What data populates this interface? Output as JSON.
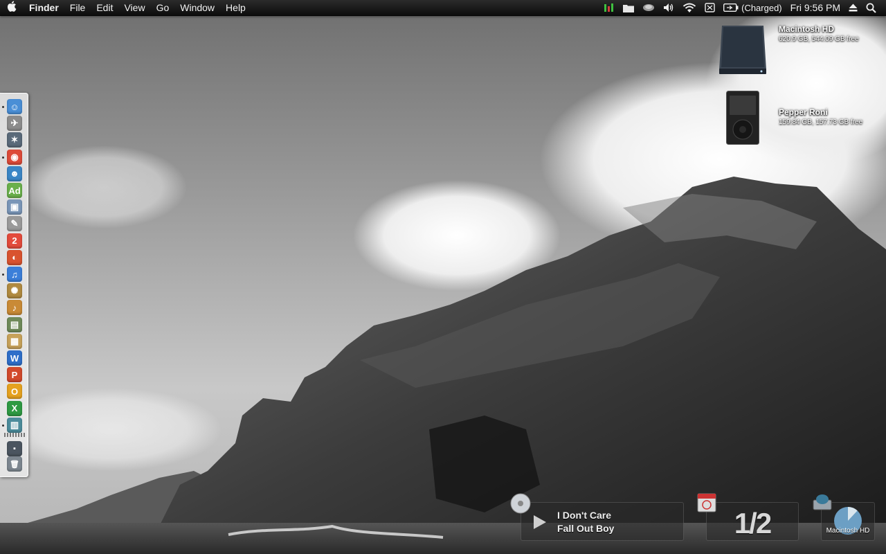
{
  "menubar": {
    "apple_icon": "apple-icon",
    "app_name": "Finder",
    "menus": [
      "File",
      "Edit",
      "View",
      "Go",
      "Window",
      "Help"
    ],
    "status": {
      "battery_text": "(Charged)",
      "clock": "Fri 9:56 PM"
    }
  },
  "desktop": {
    "drives": [
      {
        "name": "Macintosh HD",
        "info": "620.9 GB, 544.09 GB free",
        "icon": "hard-drive-icon"
      },
      {
        "name": "Pepper Roni",
        "info": "159.84 GB, 157.73 GB free",
        "icon": "ipod-icon"
      }
    ]
  },
  "dock": {
    "items": [
      {
        "name": "finder",
        "glyph": "☺",
        "color": "#4a8fd6",
        "running": true
      },
      {
        "name": "launchpad",
        "glyph": "✈",
        "color": "#8c8c8c",
        "running": false
      },
      {
        "name": "safari",
        "glyph": "✶",
        "color": "#5a6a7a",
        "running": false
      },
      {
        "name": "chrome",
        "glyph": "◉",
        "color": "#dd4b39",
        "running": true
      },
      {
        "name": "messenger",
        "glyph": "☻",
        "color": "#3b86c6",
        "running": false
      },
      {
        "name": "adium",
        "glyph": "Ad",
        "color": "#6ab04c",
        "running": false
      },
      {
        "name": "preview",
        "glyph": "▣",
        "color": "#7a96b8",
        "running": false
      },
      {
        "name": "script-editor",
        "glyph": "✎",
        "color": "#9a9a9a",
        "running": false
      },
      {
        "name": "calendar",
        "glyph": "2",
        "color": "#e34b3c",
        "running": false
      },
      {
        "name": "photo-booth",
        "glyph": "◐",
        "color": "#d9532f",
        "running": false
      },
      {
        "name": "itunes",
        "glyph": "♫",
        "color": "#3b7fd9",
        "running": true
      },
      {
        "name": "utility",
        "glyph": "✺",
        "color": "#b08a40",
        "running": false
      },
      {
        "name": "garageband",
        "glyph": "♪",
        "color": "#c98a36",
        "running": false
      },
      {
        "name": "iphoto",
        "glyph": "▤",
        "color": "#6f8a5a",
        "running": false
      },
      {
        "name": "image-viewer",
        "glyph": "▦",
        "color": "#c7a25a",
        "running": false
      },
      {
        "name": "word",
        "glyph": "W",
        "color": "#2f6fc9",
        "running": false
      },
      {
        "name": "powerpoint",
        "glyph": "P",
        "color": "#d24a2c",
        "running": false
      },
      {
        "name": "outlook",
        "glyph": "O",
        "color": "#e6a21f",
        "running": false
      },
      {
        "name": "excel",
        "glyph": "X",
        "color": "#2e9a43",
        "running": false
      },
      {
        "name": "system-monitor",
        "glyph": "▥",
        "color": "#4c8c9c",
        "running": true
      }
    ],
    "after_separator": [
      {
        "name": "downloads-stack",
        "glyph": "▪",
        "color": "#4b5560"
      },
      {
        "name": "trash",
        "glyph": "🗑",
        "color": "#7d8790"
      }
    ]
  },
  "widgets": {
    "now_playing": {
      "title": "I Don't Care",
      "artist": "Fall Out Boy"
    },
    "counter": {
      "text": "1/2"
    },
    "disk": {
      "label": "Macintosh HD",
      "used_fraction": 0.12
    }
  }
}
